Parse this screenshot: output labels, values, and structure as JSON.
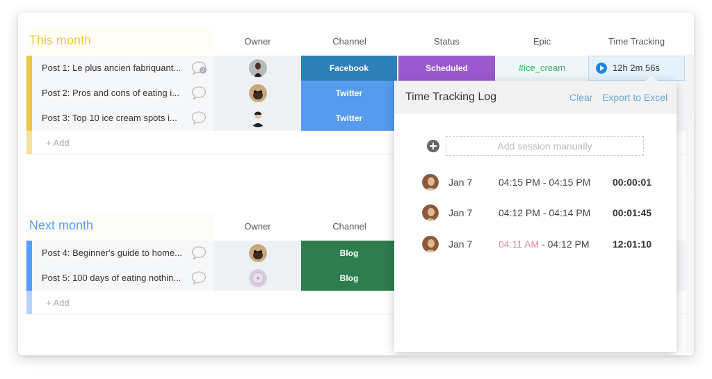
{
  "colors": {
    "this_month_accent": "#ecc84a",
    "next_month_accent": "#579bfc",
    "facebook": "#2f7fb8",
    "twitter": "#579bef",
    "blog": "#2e7d4f",
    "scheduled": "#9b59d0",
    "epic_text": "#33b95f",
    "link": "#6ea8d8",
    "warn_time": "#e08a95"
  },
  "columns": {
    "owner": "Owner",
    "channel": "Channel",
    "status": "Status",
    "epic": "Epic",
    "time_tracking": "Time Tracking"
  },
  "groups": [
    {
      "title": "This month",
      "add_label": "+ Add",
      "rows": [
        {
          "name": "Post 1: Le plus ancien fabriquant...",
          "comments": "2",
          "owner": "woman-avatar",
          "channel": "Facebook",
          "status": "Scheduled",
          "epic": "#ice_cream",
          "time": "12h 2m 56s"
        },
        {
          "name": "Post 2: Pros and cons of eating i...",
          "comments": "",
          "owner": "pug-avatar",
          "channel": "Twitter"
        },
        {
          "name": "Post 3: Top 10 ice cream spots i...",
          "comments": "",
          "owner": "man-avatar",
          "channel": "Twitter"
        }
      ]
    },
    {
      "title": "Next month",
      "add_label": "+ Add",
      "rows": [
        {
          "name": "Post 4: Beginner's guide to home...",
          "comments": "",
          "owner": "pug-avatar",
          "channel": "Blog"
        },
        {
          "name": "Post 5: 100 days of eating nothin...",
          "comments": "",
          "owner": "flower-avatar",
          "channel": "Blog"
        }
      ]
    }
  ],
  "time_log": {
    "title": "Time Tracking Log",
    "clear_label": "Clear",
    "export_label": "Export to Excel",
    "add_placeholder": "Add session manually",
    "sessions": [
      {
        "date": "Jan 7",
        "start": "04:15 PM",
        "end": "04:15 PM",
        "duration": "00:00:01"
      },
      {
        "date": "Jan 7",
        "start": "04:12 PM",
        "end": "04:14 PM",
        "duration": "00:01:45"
      },
      {
        "date": "Jan 7",
        "start": "04:11 AM",
        "end": "04:12 PM",
        "duration": "12:01:10"
      }
    ]
  }
}
